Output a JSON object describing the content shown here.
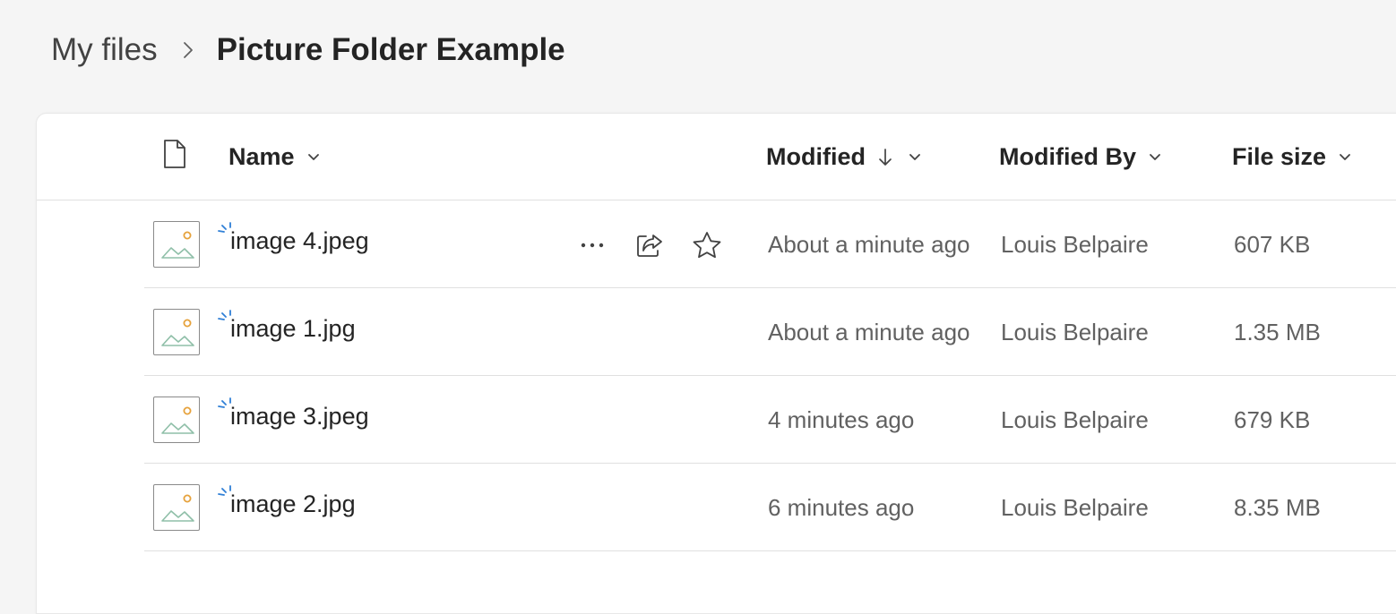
{
  "breadcrumb": {
    "root": "My files",
    "current": "Picture Folder Example"
  },
  "columns": {
    "name": "Name",
    "modified": "Modified",
    "modified_by": "Modified By",
    "file_size": "File size"
  },
  "files": [
    {
      "name": "image 4.jpeg",
      "modified": "About a minute ago",
      "modified_by": "Louis Belpaire",
      "size": "607 KB"
    },
    {
      "name": "image 1.jpg",
      "modified": "About a minute ago",
      "modified_by": "Louis Belpaire",
      "size": "1.35 MB"
    },
    {
      "name": "image 3.jpeg",
      "modified": "4 minutes ago",
      "modified_by": "Louis Belpaire",
      "size": "679 KB"
    },
    {
      "name": "image 2.jpg",
      "modified": "6 minutes ago",
      "modified_by": "Louis Belpaire",
      "size": "8.35 MB"
    }
  ],
  "colors": {
    "new_indicator": "#2f7fd6",
    "thumb_sun": "#e6a23c",
    "thumb_mountain": "#8fbfa8"
  }
}
